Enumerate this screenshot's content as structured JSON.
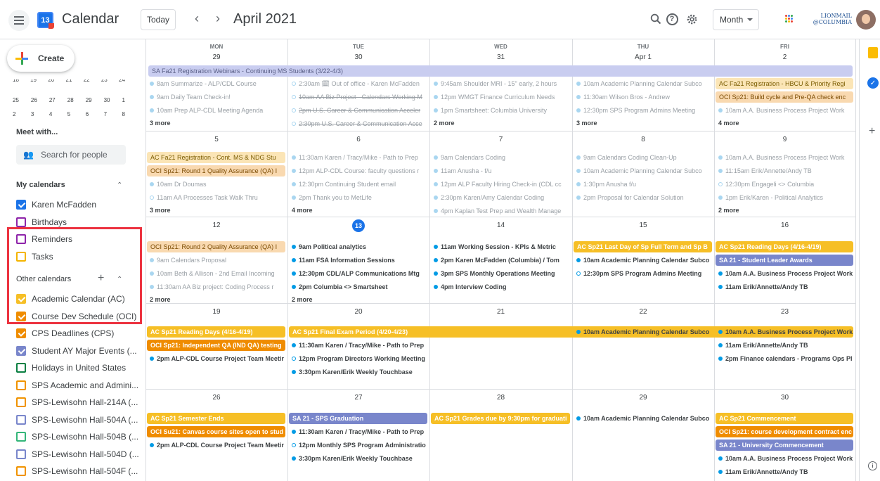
{
  "header": {
    "app_title": "Calendar",
    "logo_number": "13",
    "today_label": "Today",
    "prev_label": "‹",
    "next_label": "›",
    "month_title": "April 2021",
    "help_label": "?",
    "view_label": "Month",
    "brand_line1": "LIONMAIL",
    "brand_line2": "@COLUMBIA"
  },
  "sidebar": {
    "create_label": "Create",
    "mini_calendar_rows": [
      [
        "18",
        "19",
        "20",
        "21",
        "22",
        "23",
        "24"
      ],
      [
        "25",
        "26",
        "27",
        "28",
        "29",
        "30",
        "1"
      ],
      [
        "2",
        "3",
        "4",
        "5",
        "6",
        "7",
        "8"
      ]
    ],
    "meet_with_title": "Meet with...",
    "search_people_placeholder": "Search for people",
    "my_calendars_title": "My calendars",
    "my_calendars": [
      {
        "name": "Karen McFadden",
        "color": "#1a73e8",
        "checked": true
      },
      {
        "name": "Birthdays",
        "color": "#8e24aa",
        "checked": false
      },
      {
        "name": "Reminders",
        "color": "#8e24aa",
        "checked": false
      },
      {
        "name": "Tasks",
        "color": "#f4b400",
        "checked": false
      }
    ],
    "other_calendars_title": "Other calendars",
    "other_calendars": [
      {
        "name": "Academic Calendar (AC)",
        "color": "#f6bf26",
        "checked": true
      },
      {
        "name": "Course Dev Schedule (OCI)",
        "color": "#ef8c00",
        "checked": true
      },
      {
        "name": "CPS Deadlines (CPS)",
        "color": "#ef8c00",
        "checked": true
      },
      {
        "name": "Student AY Major Events (...",
        "color": "#7986cb",
        "checked": true
      },
      {
        "name": "Holidays in United States",
        "color": "#0b8043",
        "checked": false
      },
      {
        "name": "SPS Academic and Admini...",
        "color": "#f09300",
        "checked": false
      },
      {
        "name": "SPS-Lewisohn Hall-214A (...",
        "color": "#f09300",
        "checked": false
      },
      {
        "name": "SPS-Lewisohn Hall-504A (...",
        "color": "#7986cb",
        "checked": false
      },
      {
        "name": "SPS-Lewisohn Hall-504B (...",
        "color": "#33b679",
        "checked": false
      },
      {
        "name": "SPS-Lewisohn Hall-504D (...",
        "color": "#7986cb",
        "checked": false
      },
      {
        "name": "SPS-Lewisohn Hall-504F (...",
        "color": "#f09300",
        "checked": false
      }
    ]
  },
  "grid": {
    "dow": [
      "MON",
      "TUE",
      "WED",
      "THU",
      "FRI"
    ],
    "weeks": [
      [
        "29",
        "30",
        "31",
        "Apr 1",
        "2"
      ],
      [
        "5",
        "6",
        "7",
        "8",
        "9"
      ],
      [
        "12",
        "13",
        "14",
        "15",
        "16"
      ],
      [
        "19",
        "20",
        "21",
        "22",
        "23"
      ],
      [
        "26",
        "27",
        "28",
        "29",
        "30"
      ]
    ],
    "today": "13"
  },
  "events": {
    "w1_span": "SA Fa21 Registration Webinars - Continuing MS Students (3/22-4/3)",
    "w1": [
      [
        "8am Summarize - ALP/CDL Course",
        "9am Daily Team Check-in!",
        "10am Prep ALP-CDL Meeting Agenda",
        "3 more"
      ],
      [
        "2:30am 🗓 Out of office - Karen McFadden",
        "10am AA Biz Project - Calendars Working M",
        "2pm U.S. Career & Communication Acceler",
        "2:30pm U.S. Career & Communication Acce"
      ],
      [
        "9:45am Shoulder MRI - 15\" early, 2 hours",
        "12pm WMGT Finance Curriculum Needs",
        "1pm Smartsheet: Columbia University",
        "2 more"
      ],
      [
        "10am Academic Planning Calendar Subco",
        "11:30am Wilson Bros - Andrew",
        "12:30pm SPS Program Admins Meeting",
        "3 more"
      ],
      [
        "AC Fa21 Registration - HBCU & Priority Regi",
        "OCI Sp21: Build cycle and Pre-QA check enc",
        "10am A.A. Business Process Project Work",
        "4 more"
      ]
    ],
    "w2": [
      [
        "AC Fa21 Registration - Cont. MS & NDG Stu",
        "OCI Sp21: Round 1 Quality Assurance (QA) I",
        "10am Dr Doumas",
        "11am AA Processes Task Walk Thru",
        "3 more"
      ],
      [
        "11:30am Karen / Tracy/Mike - Path to Prep",
        "12pm ALP-CDL Course: faculty questions r",
        "12:30pm Continuing Student email",
        "2pm Thank you to MetLife",
        "4 more"
      ],
      [
        "9am Calendars Coding",
        "11am Anusha - f/u",
        "12pm ALP Faculty Hiring Check-in (CDL cc",
        "2:30pm Karen/Amy Calendar Coding",
        "4pm Kaplan Test Prep and Wealth Manage"
      ],
      [
        "9am Calendars Coding Clean-Up",
        "10am Academic Planning Calendar Subco",
        "1:30pm Anusha f/u",
        "2pm Proposal for Calendar Solution"
      ],
      [
        "10am A.A. Business Process Project Work",
        "11:15am Erik/Annette/Andy TB",
        "12:30pm Engageli <> Columbia",
        "1pm Erik/Karen - Political Analytics",
        "2 more"
      ]
    ],
    "w3": [
      [
        "OCI Sp21: Round 2 Quality Assurance (QA) I",
        "9am Calendars Proposal",
        "10am Beth & Allison - 2nd Email Incoming",
        "11:30am AA Biz project: Coding Process r",
        "2 more"
      ],
      [
        "9am Political analytics",
        "11am FSA Information Sessions",
        "12:30pm CDL/ALP Communications Mtg",
        "2pm Columbia <> Smartsheet",
        "2 more"
      ],
      [
        "11am Working Session - KPIs & Metric",
        "2pm Karen McFadden (Columbia) / Tom",
        "3pm SPS Monthly Operations Meeting",
        "4pm Interview Coding"
      ],
      [
        "AC Sp21 Last Day of Sp Full Term and Sp B",
        "10am Academic Planning Calendar Subco",
        "12:30pm SPS Program Admins Meeting"
      ],
      [
        "AC Sp21 Reading Days (4/16-4/19)",
        "SA 21 - Student Leader Awards",
        "10am A.A. Business Process Project Work",
        "11am Erik/Annette/Andy TB"
      ]
    ],
    "w4": [
      [
        "AC Sp21 Reading Days (4/16-4/19)",
        "OCI Sp21: Independent QA (IND QA) testing",
        "2pm ALP-CDL Course Project Team Meetir"
      ],
      [
        "AC Sp21 Final Exam Period (4/20-4/23)",
        "11:30am Karen / Tracy/Mike - Path to Prep",
        "12pm Program Directors Working Meeting",
        "3:30pm Karen/Erik Weekly Touchbase"
      ],
      [],
      [
        "10am Academic Planning Calendar Subco"
      ],
      [
        "10am A.A. Business Process Project Work",
        "11am Erik/Annette/Andy TB",
        "2pm Finance calendars - Programs Ops Pl"
      ]
    ],
    "w5": [
      [
        "AC Sp21 Semester Ends",
        "OCI Su21: Canvas course sites open to stud",
        "2pm ALP-CDL Course Project Team Meetir"
      ],
      [
        "SA 21 - SPS Graduation",
        "11:30am Karen / Tracy/Mike - Path to Prep",
        "12pm Monthly SPS Program Administratio",
        "3:30pm Karen/Erik Weekly Touchbase"
      ],
      [
        "AC Sp21 Grades due by 9:30pm for graduati"
      ],
      [
        "10am Academic Planning Calendar Subco"
      ],
      [
        "AC Sp21 Commencement",
        "OCI Sp21: course development contract enc",
        "SA 21 - University Commencement",
        "10am A.A. Business Process Project Work",
        "11am Erik/Annette/Andy TB"
      ]
    ]
  },
  "colors": {
    "ac_yellow": "#f6bf26",
    "oci_orange": "#ef8c00",
    "sa_lavender": "#7986cb",
    "sa_light": "#c9cdf0",
    "past_yellow": "#fbe5b6",
    "past_orange": "#f9d9b0",
    "primary_blue": "#039be5",
    "today_blue": "#1a73e8"
  }
}
